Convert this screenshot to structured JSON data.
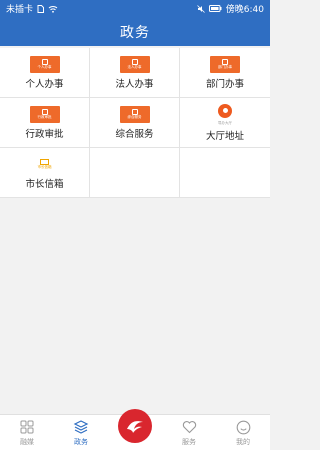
{
  "status_bar": {
    "carrier": "未插卡",
    "time": "傍晚6:40"
  },
  "nav": {
    "title": "政务"
  },
  "grid": [
    {
      "label": "个人办事",
      "tile_text": "个人办事"
    },
    {
      "label": "法人办事",
      "tile_text": "法人办事"
    },
    {
      "label": "部门办事",
      "tile_text": "部门办事"
    },
    {
      "label": "行政审批",
      "tile_text": "行政审批"
    },
    {
      "label": "综合服务",
      "tile_text": "综合服务"
    },
    {
      "label": "大厅地址",
      "tile_text": "导办大厅"
    },
    {
      "label": "市长信箱",
      "tile_text": "市长信箱"
    }
  ],
  "tabs": [
    {
      "label": "融媒",
      "icon": "grid-icon"
    },
    {
      "label": "政务",
      "icon": "layers-icon",
      "active": true
    },
    {
      "label": "",
      "icon": "center-logo"
    },
    {
      "label": "服务",
      "icon": "heart-icon"
    },
    {
      "label": "我的",
      "icon": "smile-icon"
    }
  ],
  "colors": {
    "brand_blue": "#2f6ec2",
    "accent_orange": "#ee6a2a",
    "logo_red": "#d9262e"
  }
}
